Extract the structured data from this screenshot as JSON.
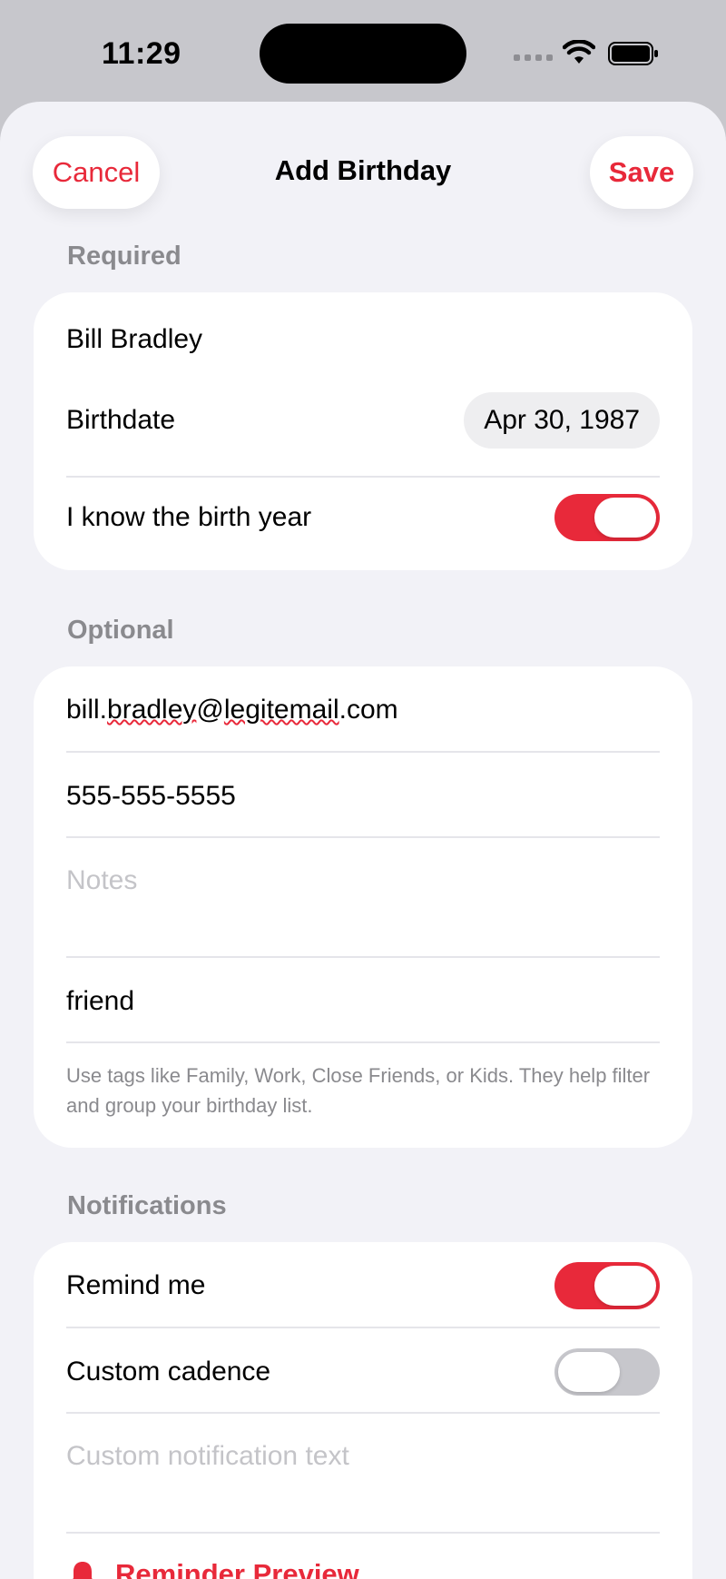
{
  "status_bar": {
    "time": "11:29"
  },
  "nav": {
    "cancel_label": "Cancel",
    "title": "Add Birthday",
    "save_label": "Save"
  },
  "required": {
    "header": "Required",
    "name_value": "Bill Bradley",
    "birthdate_label": "Birthdate",
    "birthdate_value": "Apr 30, 1987",
    "birth_year_label": "I know the birth year",
    "birth_year_on": true
  },
  "optional": {
    "header": "Optional",
    "email_prefix": "bill.",
    "email_misspelled_1": "bradley",
    "email_at": "@",
    "email_misspelled_2": "legitemail",
    "email_suffix": ".com",
    "phone_value": "555-555-5555",
    "notes_placeholder": "Notes",
    "tags_value": "friend",
    "tags_hint": "Use tags like Family, Work, Close Friends, or Kids. They help filter and group your birthday list."
  },
  "notifications": {
    "header": "Notifications",
    "remind_label": "Remind me",
    "remind_on": true,
    "cadence_label": "Custom cadence",
    "cadence_on": false,
    "custom_text_placeholder": "Custom notification text",
    "reminder_link_partial": "Reminder Preview"
  },
  "colors": {
    "accent": "#e8293a",
    "background": "#f2f2f7",
    "secondary_text": "#8a8a8e"
  },
  "icons": [
    "wifi-icon",
    "battery-icon",
    "cellular-signal-icon",
    "bell-icon"
  ]
}
